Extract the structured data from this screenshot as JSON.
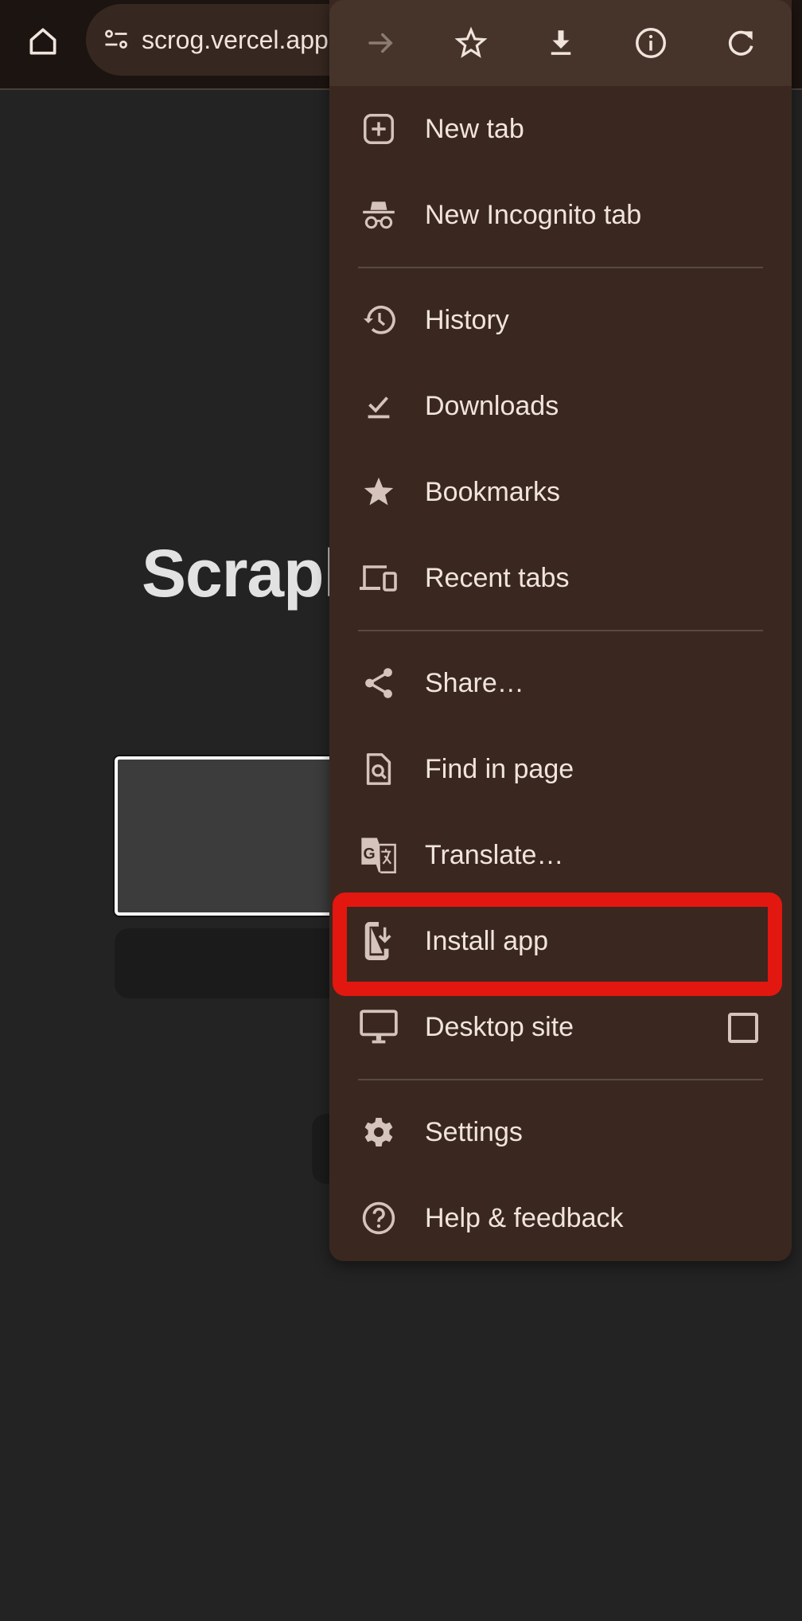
{
  "toolbar": {
    "home_icon": "home-icon",
    "site_settings_icon": "tune-icon",
    "url": "scrog.vercel.app"
  },
  "page": {
    "title_partial": "Scrapl",
    "textarea_value": "",
    "button_label": "",
    "secondary_button_label": ""
  },
  "menu": {
    "top_actions": [
      {
        "name": "forward",
        "icon": "arrow-forward-icon",
        "enabled": false
      },
      {
        "name": "bookmark",
        "icon": "star-outline-icon",
        "enabled": true
      },
      {
        "name": "download",
        "icon": "download-icon",
        "enabled": true
      },
      {
        "name": "page-info",
        "icon": "info-icon",
        "enabled": true
      },
      {
        "name": "reload",
        "icon": "refresh-icon",
        "enabled": true
      }
    ],
    "groups": [
      [
        {
          "label": "New tab",
          "icon": "new-tab-icon"
        },
        {
          "label": "New Incognito tab",
          "icon": "incognito-icon"
        }
      ],
      [
        {
          "label": "History",
          "icon": "history-icon"
        },
        {
          "label": "Downloads",
          "icon": "downloads-done-icon"
        },
        {
          "label": "Bookmarks",
          "icon": "star-filled-icon"
        },
        {
          "label": "Recent tabs",
          "icon": "devices-icon"
        }
      ],
      [
        {
          "label": "Share…",
          "icon": "share-icon"
        },
        {
          "label": "Find in page",
          "icon": "find-in-page-icon"
        },
        {
          "label": "Translate…",
          "icon": "translate-icon"
        },
        {
          "label": "Install app",
          "icon": "install-mobile-icon",
          "highlighted": true
        },
        {
          "label": "Desktop site",
          "icon": "desktop-icon",
          "checkbox": true,
          "checked": false
        }
      ],
      [
        {
          "label": "Settings",
          "icon": "gear-icon"
        },
        {
          "label": "Help & feedback",
          "icon": "help-icon"
        }
      ]
    ]
  },
  "colors": {
    "menu_bg": "#3a2820",
    "menu_top_bg": "#46342a",
    "text": "#f0e4dc",
    "icon": "#d4c4bb",
    "highlight": "#e2170f",
    "page_bg": "#232323"
  }
}
